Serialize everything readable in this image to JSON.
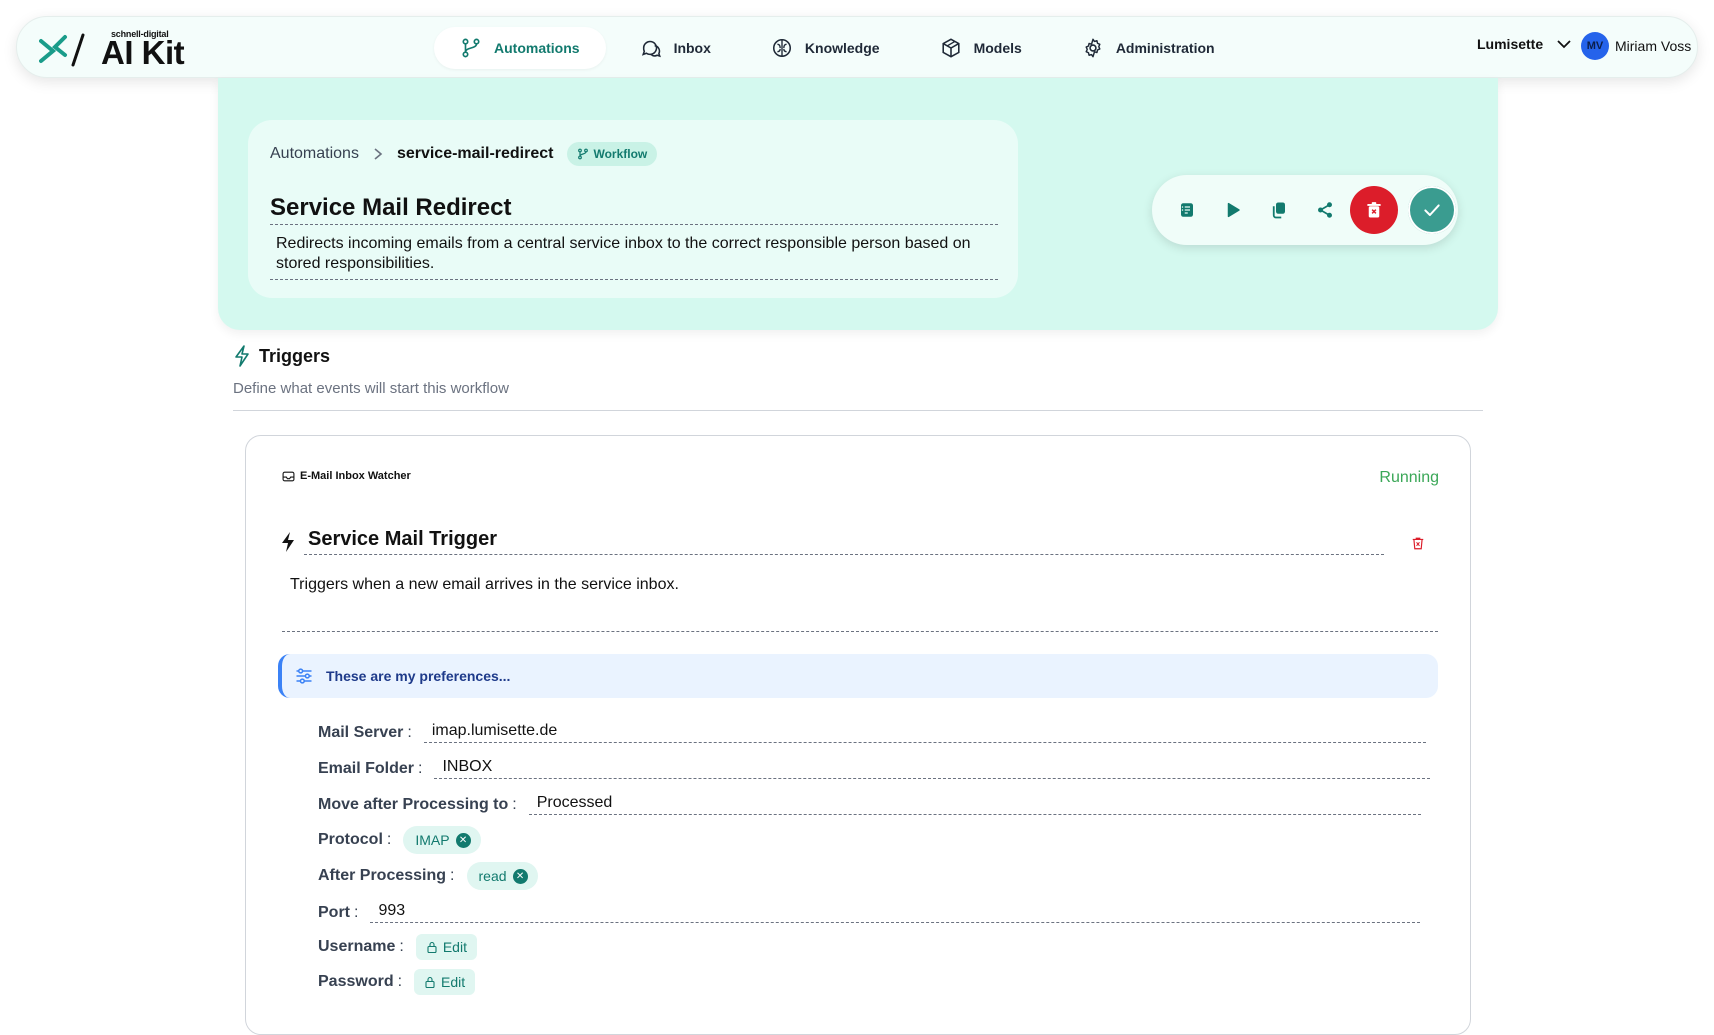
{
  "app": {
    "brand_small": "schnell-digital",
    "brand_big": "AI Kit"
  },
  "nav": [
    {
      "label": "Automations",
      "icon": "workflow-icon",
      "active": true
    },
    {
      "label": "Inbox",
      "icon": "chat-bubbles-icon",
      "active": false
    },
    {
      "label": "Knowledge",
      "icon": "brain-icon",
      "active": false
    },
    {
      "label": "Models",
      "icon": "cube-icon",
      "active": false
    },
    {
      "label": "Administration",
      "icon": "gear-icon",
      "active": false
    }
  ],
  "org": {
    "name": "Lumisette"
  },
  "user": {
    "initials": "MV",
    "name": "Miriam Voss"
  },
  "breadcrumb": {
    "root": "Automations",
    "separator": ">",
    "current": "service-mail-redirect",
    "tag": "Workflow"
  },
  "workflow": {
    "title": "Service Mail Redirect",
    "description": "Redirects incoming emails from a central service inbox to the correct responsible person based on stored responsibilities."
  },
  "toolbar": {
    "icons": [
      "notes-icon",
      "play-icon",
      "copy-icon",
      "share-icon",
      "delete-icon",
      "confirm-icon"
    ]
  },
  "triggers": {
    "title": "Triggers",
    "subtitle": "Define what events will start this workflow"
  },
  "trigger": {
    "type": "E-Mail Inbox Watcher",
    "status": "Running",
    "name": "Service Mail Trigger",
    "description": "Triggers when a new email arrives in the service inbox.",
    "preferences": "These are my preferences...",
    "fields": {
      "mail_server": {
        "label": "Mail Server",
        "value": "imap.lumisette.de"
      },
      "email_folder": {
        "label": "Email Folder",
        "value": "INBOX"
      },
      "move_after": {
        "label": "Move after Processing to",
        "value": "Processed"
      },
      "protocol": {
        "label": "Protocol",
        "value": "IMAP"
      },
      "after_processing": {
        "label": "After Processing",
        "value": "read"
      },
      "port": {
        "label": "Port",
        "value": "993"
      },
      "username": {
        "label": "Username",
        "value": "Edit"
      },
      "password": {
        "label": "Password",
        "value": "Edit"
      }
    },
    "colon": ":"
  },
  "colors": {
    "accent": "#127a6e",
    "hero_bg": "#d4f9ef",
    "danger": "#dc1d2a",
    "running": "#3aa757",
    "info": "#3b82f6"
  }
}
